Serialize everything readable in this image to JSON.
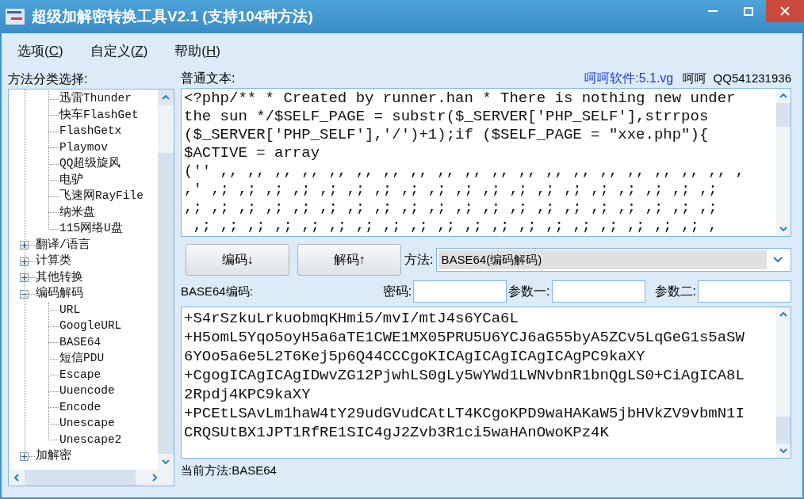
{
  "window": {
    "title": "超级加解密转换工具V2.1 (支持104种方法)"
  },
  "menu": [
    {
      "text": "选项(",
      "mnemonic": "C",
      "after": ")"
    },
    {
      "text": "自定义(",
      "mnemonic": "Z",
      "after": ")"
    },
    {
      "text": "帮助(",
      "mnemonic": "H",
      "after": ")"
    }
  ],
  "sidebar": {
    "label": "方法分类选择:",
    "tree": [
      {
        "expanded": true,
        "children": [
          {
            "label": "迅雷Thunder"
          },
          {
            "label": "快车FlashGet"
          },
          {
            "label": "FlashGetx"
          },
          {
            "label": "Playmov"
          },
          {
            "label": "QQ超级旋风"
          },
          {
            "label": "电驴"
          },
          {
            "label": "飞速网RayFile"
          },
          {
            "label": "纳米盘"
          },
          {
            "label": "115网络U盘"
          }
        ]
      },
      {
        "label": "翻译/语言",
        "expanded": false
      },
      {
        "label": "计算类",
        "expanded": false
      },
      {
        "label": "其他转换",
        "expanded": false
      },
      {
        "label": "编码解码",
        "expanded": true,
        "children": [
          {
            "label": "URL"
          },
          {
            "label": "GoogleURL"
          },
          {
            "label": "BASE64"
          },
          {
            "label": "短信PDU"
          },
          {
            "label": "Escape"
          },
          {
            "label": "Uuencode"
          },
          {
            "label": "Encode"
          },
          {
            "label": "Unescape"
          },
          {
            "label": "Unescape2"
          }
        ]
      },
      {
        "label": "加解密",
        "expanded": false
      }
    ]
  },
  "plain_text": {
    "label": "普通文本:",
    "lines": [
      "<?php/** * Created by runner.han * There is nothing new under",
      "the sun */$SELF_PAGE = substr($_SERVER['PHP_SELF'],strrpos",
      "($_SERVER['PHP_SELF'],'/')+1);if ($SELF_PAGE = \"xxe.php\"){",
      "$ACTIVE = array",
      "('' ,, ,, ,, ,, ,, ,, ,, ,, ,, ,, ,, ,, ,, ,, ,, ,, ,, ,, ,, ,",
      ",' ,; ,; ,; ,; ,; ,; ,; ,; ,; ,; ,; ,; ,; ,; ,; ,; ,; ,; ,;",
      ",; ,; ,; ,; ,; ,; ,; ,; ,; ,; ,; ,; ,; ,; ,; ,; ,; ,; ,; ,;",
      " ,; ,; ,; ,; ,; ,; ,; ,; ,; ,; ,; ,; ,; ,; ,; ,; ,; ,; ,; ,"
    ]
  },
  "credits": {
    "link": "呵呵软件:5.1.vg",
    "text": "呵呵  QQ541231936"
  },
  "buttons": [
    {
      "label": "编码↓"
    },
    {
      "label": "解码↑"
    }
  ],
  "method": {
    "label": "方法:",
    "value": "BASE64(编码解码)"
  },
  "encoded": {
    "label": "BASE64编码:",
    "lines": [
      "+S4rSzkuLrkuobmqKHmi5/mvI/mtJ4s6YCa6L",
      "+H5omL5Yqo5oyH5a6aTE1CWE1MX05PRU5U6YCJ6aG55byA5ZCv5LqGeG1s5aSW",
      "6YOo5a6e5L2T6Kej5p6Q44CCCgoKICAgICAgICAgICAgPC9kaXY",
      "+CgogICAgICAgIDwvZG12PjwhLS0gLy5wYWd1LWNvbnR1bnQgLS0+CiAgICA8L",
      "2Rpdj4KPC9kaXY",
      "+PCEtLSAvLm1haW4tY29udGVudCAtLT4KCgoKPD9waHAKaW5jbHVkZV9vbmN1I",
      "CRQSUtBX1JPT1RfRE1SIC4gJ2Zvb3R1ci5waHAnOwoKPz4K"
    ]
  },
  "params": [
    {
      "label": "密码:"
    },
    {
      "label": "参数一:"
    },
    {
      "label": "参数二:"
    }
  ],
  "status_bar": {
    "text": "当前方法:BASE64"
  }
}
